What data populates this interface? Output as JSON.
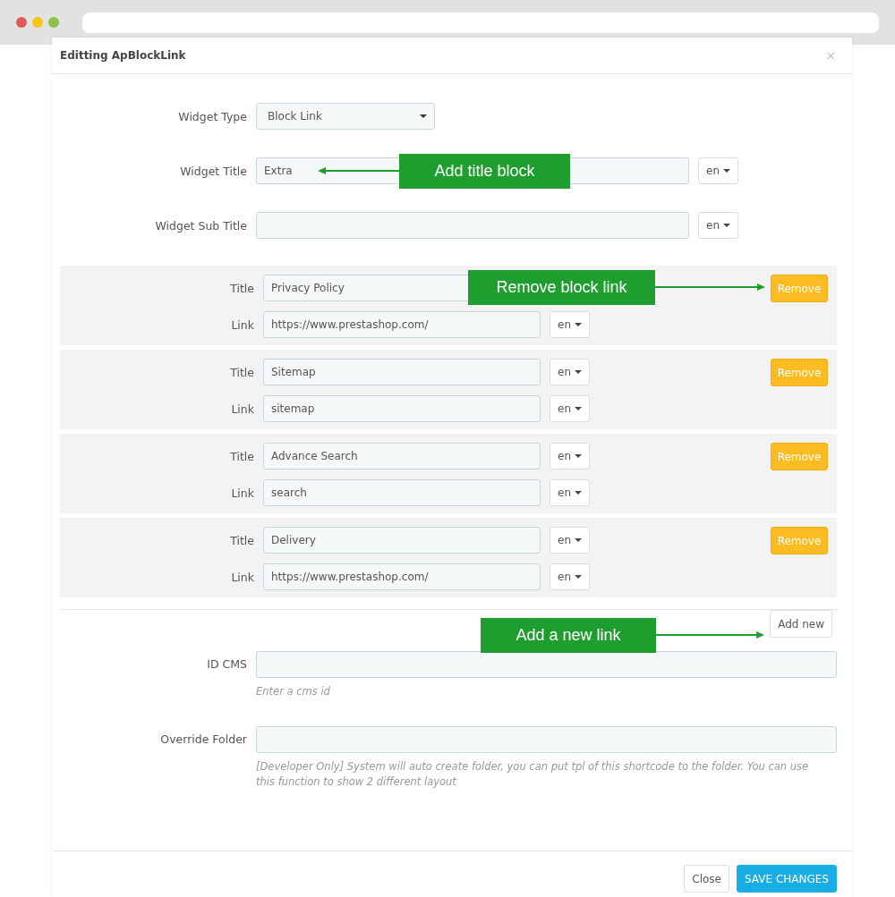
{
  "modal": {
    "title": "Editting ApBlockLink",
    "close": "×"
  },
  "widget_type": {
    "label": "Widget Type",
    "value": "Block Link"
  },
  "widget_fields": [
    {
      "label": "Widget Title",
      "value": "Extra",
      "language": "en"
    },
    {
      "label": "Widget Sub Title",
      "language": "en"
    }
  ],
  "links": [
    {
      "title_label": "Title",
      "title": "Privacy Policy",
      "link_label": "Link",
      "link": "https://www.prestashop.com/",
      "link_language": "en",
      "remove": "Remove"
    },
    {
      "title_label": "Title",
      "title": "Sitemap",
      "title_language": "en",
      "link_label": "Link",
      "link": "sitemap",
      "link_language": "en",
      "remove": "Remove"
    },
    {
      "title_label": "Title",
      "title": "Advance Search",
      "title_language": "en",
      "link_label": "Link",
      "link": "search",
      "link_language": "en",
      "remove": "Remove"
    },
    {
      "title_label": "Title",
      "title": "Delivery",
      "title_language": "en",
      "link_label": "Link",
      "link": "https://www.prestashop.com/",
      "link_language": "en",
      "remove": "Remove"
    }
  ],
  "add_new": "Add new",
  "extra_fields": [
    {
      "label": "ID CMS",
      "help": "Enter a cms id"
    },
    {
      "label": "Override Folder",
      "help": "[Developer Only] System will auto create folder, you can put tpl of this shortcode to the folder. You can use this function to show 2 different layout"
    }
  ],
  "footer": {
    "close": "Close",
    "save": "SAVE CHANGES"
  },
  "callouts": [
    {
      "text": "Add title block"
    },
    {
      "text": "Remove block link"
    },
    {
      "text": "Add a new link"
    }
  ]
}
